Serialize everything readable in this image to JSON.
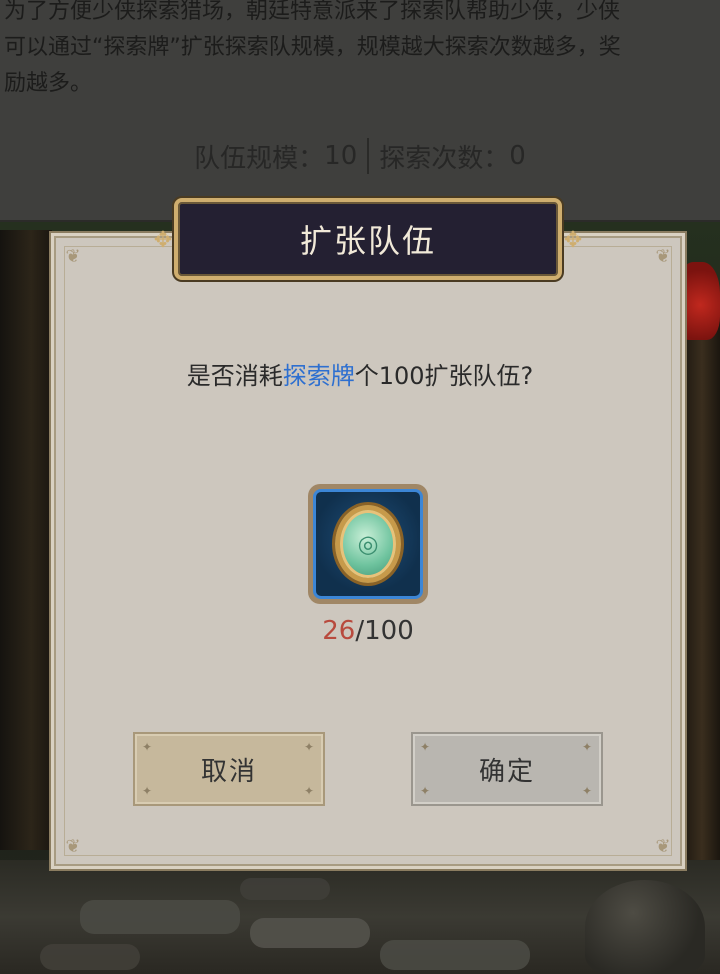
{
  "description": {
    "line1": "为了方便少侠探索猎场，朝廷特意派来了探索队帮助少侠，少侠",
    "line2": "可以通过“探索牌”扩张探索队规模，规模越大探索次数越多，奖",
    "line3": "励越多。"
  },
  "stats": {
    "team_size_label": "队伍规模：",
    "team_size_value": "10",
    "explore_count_label": "探索次数：",
    "explore_count_value": "0"
  },
  "dialog": {
    "title": "扩张队伍",
    "prompt_prefix": "是否消耗",
    "prompt_item": "探索牌",
    "prompt_suffix": "个100扩张队伍?",
    "item_icon": "exploration-token-icon",
    "item_glyph": "◎",
    "owned": "26",
    "required": "/100",
    "cancel_label": "取消",
    "confirm_label": "确定"
  },
  "colors": {
    "highlight": "#2d6fd0",
    "insufficient": "#b84a3d",
    "title_plate": "#242032",
    "gold_border": "#cfae6f"
  }
}
